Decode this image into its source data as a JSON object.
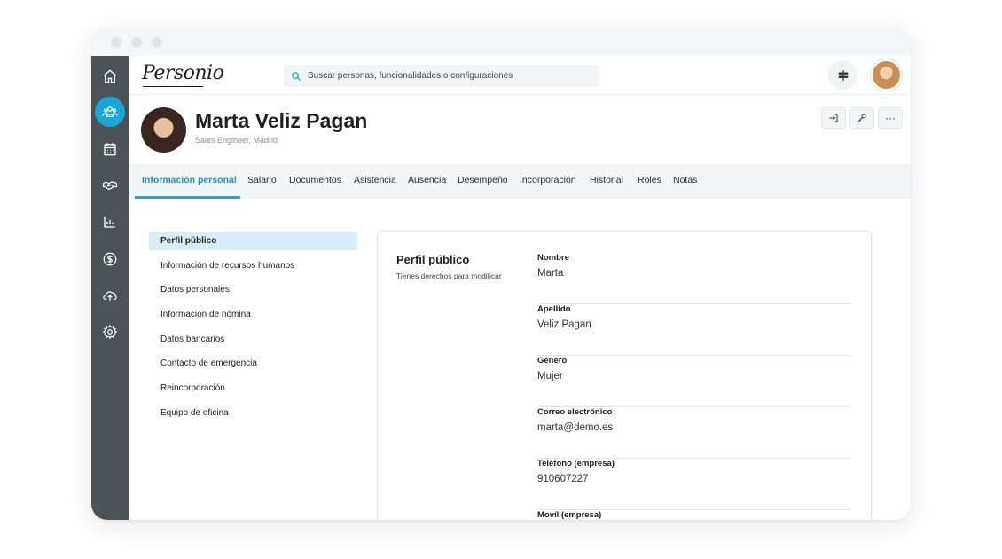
{
  "app": {
    "logo": "Personio"
  },
  "search": {
    "placeholder": "Buscar personas, funcionalidades o configuraciones"
  },
  "sidebar": {
    "items": [
      {
        "icon": "home-icon"
      },
      {
        "icon": "people-icon",
        "active": true
      },
      {
        "icon": "calendar-icon"
      },
      {
        "icon": "handshake-icon"
      },
      {
        "icon": "chart-icon"
      },
      {
        "icon": "dollar-icon"
      },
      {
        "icon": "cloud-upload-icon"
      },
      {
        "icon": "gear-icon"
      }
    ]
  },
  "profile": {
    "name": "Marta Veliz Pagan",
    "subtitle": "Sales Engineer, Madrid"
  },
  "header_actions": {
    "more": "···"
  },
  "tabs": [
    {
      "label": "Información personal",
      "active": true
    },
    {
      "label": "Salario"
    },
    {
      "label": "Documentos"
    },
    {
      "label": "Asistencia"
    },
    {
      "label": "Ausencia"
    },
    {
      "label": "Desempeño"
    },
    {
      "label": "Incorporación"
    },
    {
      "label": "Historial"
    },
    {
      "label": "Roles"
    },
    {
      "label": "Notas"
    }
  ],
  "subnav": [
    {
      "label": "Perfil público",
      "active": true
    },
    {
      "label": "Información de recursos humanos"
    },
    {
      "label": "Datos personales"
    },
    {
      "label": "Información de nómina"
    },
    {
      "label": "Datos bancarios"
    },
    {
      "label": "Contacto de emergencia"
    },
    {
      "label": "Reincorporación"
    },
    {
      "label": "Equipo de oficina"
    }
  ],
  "card": {
    "title": "Perfil público",
    "subtitle": "Tienes derechos para modificar",
    "fields": [
      {
        "label": "Nombre",
        "value": "Marta"
      },
      {
        "label": "Apellido",
        "value": "Veliz Pagan"
      },
      {
        "label": "Género",
        "value": "Mujer"
      },
      {
        "label": "Correo electrónico",
        "value": "marta@demo.es"
      },
      {
        "label": "Teléfono (empresa)",
        "value": "910607227"
      },
      {
        "label": "Movíl (empresa)",
        "value": ""
      }
    ]
  },
  "colors": {
    "accent": "#1aa6d6",
    "sidebar": "#4b5357"
  }
}
